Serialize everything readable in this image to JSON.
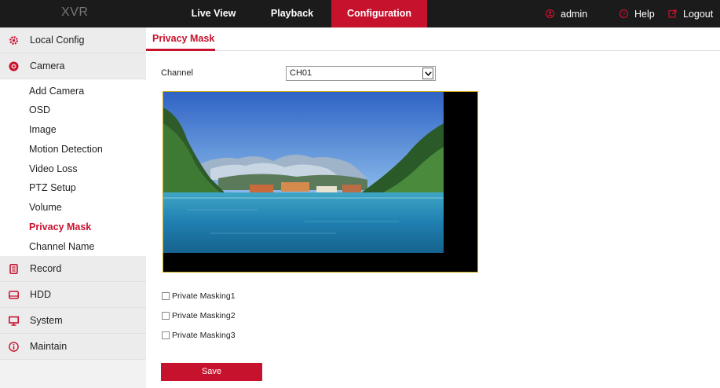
{
  "header": {
    "logo": "XVR",
    "tabs": [
      {
        "label": "Live View"
      },
      {
        "label": "Playback"
      },
      {
        "label": "Configuration"
      }
    ],
    "user": "admin",
    "help": "Help",
    "logout": "Logout",
    "accent_color": "#c7122d"
  },
  "sidebar": {
    "local_config": "Local Config",
    "camera": "Camera",
    "camera_items": [
      {
        "label": "Add Camera"
      },
      {
        "label": "OSD"
      },
      {
        "label": "Image"
      },
      {
        "label": "Motion Detection"
      },
      {
        "label": "Video Loss"
      },
      {
        "label": "PTZ Setup"
      },
      {
        "label": "Volume"
      },
      {
        "label": "Privacy Mask"
      },
      {
        "label": "Channel Name"
      }
    ],
    "record": "Record",
    "hdd": "HDD",
    "system": "System",
    "maintain": "Maintain"
  },
  "content": {
    "tab": "Privacy Mask",
    "channel_label": "Channel",
    "channel_value": "CH01",
    "masks": [
      {
        "label": "Private Masking1"
      },
      {
        "label": "Private Masking2"
      },
      {
        "label": "Private Masking3"
      }
    ],
    "save_label": "Save"
  }
}
